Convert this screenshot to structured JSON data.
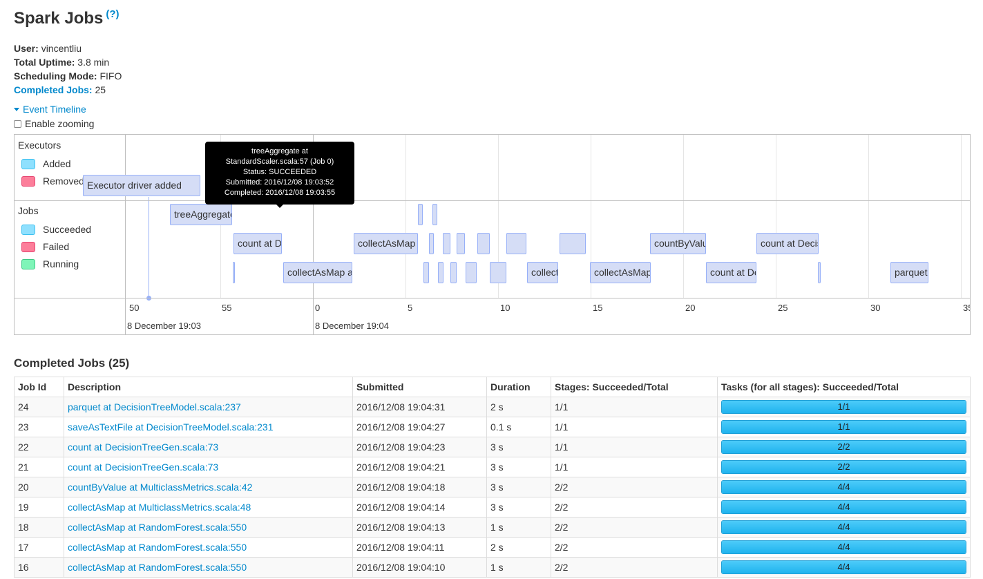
{
  "page": {
    "title": "Spark Jobs",
    "help": "(?)"
  },
  "summary": {
    "user_label": "User:",
    "user_value": "vincentliu",
    "uptime_label": "Total Uptime:",
    "uptime_value": "3.8 min",
    "scheduling_label": "Scheduling Mode:",
    "scheduling_value": "FIFO",
    "completed_label": "Completed Jobs:",
    "completed_value": "25"
  },
  "timeline": {
    "toggle_label": "Event Timeline",
    "zoom_label": "Enable zooming",
    "executors_group": "Executors",
    "executor_legend": [
      "Added",
      "Removed"
    ],
    "jobs_group": "Jobs",
    "job_legend": [
      "Succeeded",
      "Failed",
      "Running"
    ],
    "ticks": [
      "50",
      "55",
      "0",
      "5",
      "10",
      "15",
      "20",
      "25",
      "30",
      "35"
    ],
    "date_labels": [
      "8 December 19:03",
      "8 December 19:04"
    ],
    "executor_items": [
      "Executor driver added"
    ],
    "job_items": [
      "treeAggregate at StandardScaler.scala:57 (Job 0)",
      "count at DecisionTreeGen.scala",
      "collectAsMap at",
      "collectAsMap at",
      "",
      "",
      "",
      "",
      "",
      "",
      "collectAsMap at",
      "collectAsMap at",
      "countByValue at",
      "count at DecisionTreeGen.scala",
      "count at DecisionTreeGen.scala",
      "",
      "parquet at"
    ],
    "tooltip": {
      "line1": "treeAggregate at",
      "line2": "StandardScaler.scala:57 (Job 0)",
      "line3": "Status: SUCCEEDED",
      "line4": "Submitted: 2016/12/08 19:03:52",
      "line5": "Completed: 2016/12/08 19:03:55"
    },
    "colors": {
      "job_fill": "#d5ddf6",
      "job_border": "#97b0f8",
      "tooltip_bg": "#000000"
    }
  },
  "completed": {
    "title": "Completed Jobs (25)",
    "headers": [
      "Job Id",
      "Description",
      "Submitted",
      "Duration",
      "Stages: Succeeded/Total",
      "Tasks (for all stages): Succeeded/Total"
    ],
    "rows": [
      {
        "id": "24",
        "desc": "parquet at DecisionTreeModel.scala:237",
        "submitted": "2016/12/08 19:04:31",
        "duration": "2 s",
        "stages": "1/1",
        "tasks": "1/1",
        "progress": 1.0
      },
      {
        "id": "23",
        "desc": "saveAsTextFile at DecisionTreeModel.scala:231",
        "submitted": "2016/12/08 19:04:27",
        "duration": "0.1 s",
        "stages": "1/1",
        "tasks": "1/1",
        "progress": 1.0
      },
      {
        "id": "22",
        "desc": "count at DecisionTreeGen.scala:73",
        "submitted": "2016/12/08 19:04:23",
        "duration": "3 s",
        "stages": "1/1",
        "tasks": "2/2",
        "progress": 1.0
      },
      {
        "id": "21",
        "desc": "count at DecisionTreeGen.scala:73",
        "submitted": "2016/12/08 19:04:21",
        "duration": "3 s",
        "stages": "1/1",
        "tasks": "2/2",
        "progress": 1.0
      },
      {
        "id": "20",
        "desc": "countByValue at MulticlassMetrics.scala:42",
        "submitted": "2016/12/08 19:04:18",
        "duration": "3 s",
        "stages": "2/2",
        "tasks": "4/4",
        "progress": 1.0
      },
      {
        "id": "19",
        "desc": "collectAsMap at MulticlassMetrics.scala:48",
        "submitted": "2016/12/08 19:04:14",
        "duration": "3 s",
        "stages": "2/2",
        "tasks": "4/4",
        "progress": 1.0
      },
      {
        "id": "18",
        "desc": "collectAsMap at RandomForest.scala:550",
        "submitted": "2016/12/08 19:04:13",
        "duration": "1 s",
        "stages": "2/2",
        "tasks": "4/4",
        "progress": 1.0
      },
      {
        "id": "17",
        "desc": "collectAsMap at RandomForest.scala:550",
        "submitted": "2016/12/08 19:04:11",
        "duration": "2 s",
        "stages": "2/2",
        "tasks": "4/4",
        "progress": 1.0
      },
      {
        "id": "16",
        "desc": "collectAsMap at RandomForest.scala:550",
        "submitted": "2016/12/08 19:04:10",
        "duration": "1 s",
        "stages": "2/2",
        "tasks": "4/4",
        "progress": 1.0
      }
    ]
  }
}
